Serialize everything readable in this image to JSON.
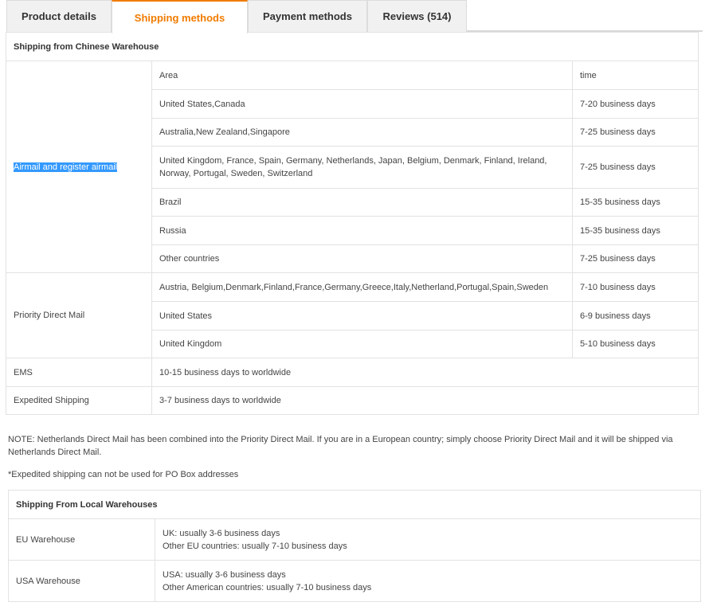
{
  "tabs": [
    {
      "label": "Product details"
    },
    {
      "label": "Shipping methods"
    },
    {
      "label": "Payment methods"
    },
    {
      "label": "Reviews (514)"
    }
  ],
  "chinese": {
    "header": "Shipping from Chinese Warehouse",
    "airmail": {
      "method": "Airmail and register airmail",
      "col_area": "Area",
      "col_time": "time",
      "rows": [
        {
          "area": "United States,Canada",
          "time": "7-20 business days"
        },
        {
          "area": "Australia,New Zealand,Singapore",
          "time": "7-25 business days"
        },
        {
          "area": "United Kingdom, France, Spain, Germany, Netherlands, Japan, Belgium, Denmark, Finland, Ireland, Norway, Portugal, Sweden, Switzerland",
          "time": "7-25 business days"
        },
        {
          "area": "Brazil",
          "time": "15-35 business days"
        },
        {
          "area": "Russia",
          "time": "15-35 business days"
        },
        {
          "area": "Other countries",
          "time": "7-25 business days"
        }
      ]
    },
    "priority": {
      "method": "Priority Direct Mail",
      "rows": [
        {
          "area": "Austria, Belgium,Denmark,Finland,France,Germany,Greece,Italy,Netherland,Portugal,Spain,Sweden",
          "time": "7-10 business days"
        },
        {
          "area": "United States",
          "time": "6-9 business days"
        },
        {
          "area": "United Kingdom",
          "time": "5-10 business days"
        }
      ]
    },
    "ems": {
      "method": "EMS",
      "desc": "10-15 business days to worldwide"
    },
    "expedited": {
      "method": "Expedited Shipping",
      "desc": "3-7 business days to worldwide"
    }
  },
  "notes": {
    "note1": "NOTE: Netherlands Direct Mail has been combined into the Priority Direct Mail. If you are in a European country; simply choose Priority Direct Mail and it will be shipped via Netherlands Direct Mail.",
    "note2": "*Expedited shipping can not be used for PO Box addresses"
  },
  "local": {
    "header": "Shipping From Local Warehouses",
    "eu": {
      "name": "EU Warehouse",
      "line1": "UK: usually 3-6 business days",
      "line2": "Other EU countries: usually 7-10 business days"
    },
    "usa": {
      "name": "USA Warehouse",
      "line1": "USA: usually 3-6 business days",
      "line2": "Other American countries: usually 7-10 business days"
    }
  }
}
